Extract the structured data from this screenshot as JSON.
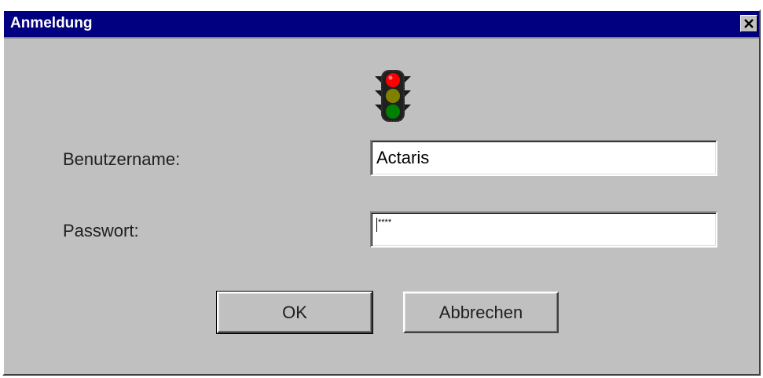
{
  "window": {
    "title": "Anmeldung",
    "close_symbol": "×"
  },
  "icons": {
    "close": "close-icon",
    "logo": "traffic-light-icon"
  },
  "colors": {
    "titlebar": "#000080",
    "dialog_bg": "#c0c0c0",
    "light_red": "#ff0000",
    "light_yellow": "#808000",
    "light_green": "#008000"
  },
  "form": {
    "username_label": "Benutzername:",
    "username_value": "Actaris",
    "password_label": "Passwort:",
    "password_value": "****"
  },
  "buttons": {
    "ok_label": "OK",
    "cancel_label": "Abbrechen"
  }
}
